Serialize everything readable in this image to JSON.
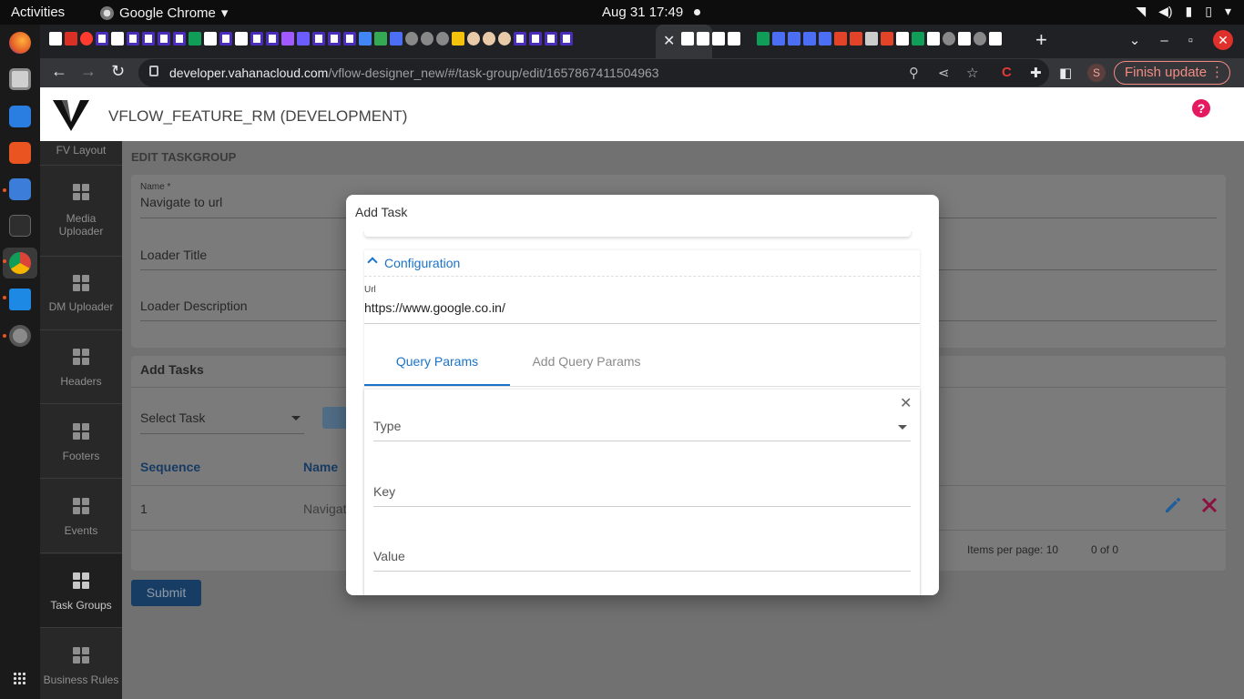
{
  "os": {
    "activities": "Activities",
    "app_name": "Google Chrome",
    "clock": "Aug 31  17:49"
  },
  "browser": {
    "url_host": "developer.vahanacloud.com",
    "url_path": "/vflow-designer_new/#/task-group/edit/1657867411504963",
    "finish_update": "Finish update",
    "profile_initial": "S"
  },
  "app": {
    "title": "VFLOW_FEATURE_RM (DEVELOPMENT)",
    "help": "?"
  },
  "sidenav": {
    "items": [
      {
        "label": "FV Layout"
      },
      {
        "label": "Media Uploader"
      },
      {
        "label": "DM Uploader"
      },
      {
        "label": "Headers"
      },
      {
        "label": "Footers"
      },
      {
        "label": "Events"
      },
      {
        "label": "Task Groups"
      },
      {
        "label": "Business Rules"
      }
    ]
  },
  "page": {
    "title": "EDIT TASKGROUP",
    "name_label": "Name *",
    "name_value": "Navigate to url",
    "loader_title": "Loader Title",
    "loader_description": "Loader Description",
    "add_tasks_header": "Add Tasks",
    "select_task": "Select Task",
    "table": {
      "headers": [
        "Sequence",
        "Name"
      ],
      "rows": [
        {
          "sequence": "1",
          "name": "Navigat"
        }
      ]
    },
    "items_per_page": "Items per page: 10",
    "range": "0 of 0",
    "submit": "Submit"
  },
  "dialog": {
    "title": "Add Task",
    "section": "Configuration",
    "url_label": "Url",
    "url_value": "https://www.google.co.in/",
    "tabs": [
      "Query Params",
      "Add Query Params"
    ],
    "fields": {
      "type": "Type",
      "key": "Key",
      "value": "Value"
    }
  },
  "colors": {
    "accent": "#1a73c9",
    "delete": "#c2185b",
    "edit": "#1f5f99",
    "help": "#e5195f",
    "submit": "#173d65"
  }
}
